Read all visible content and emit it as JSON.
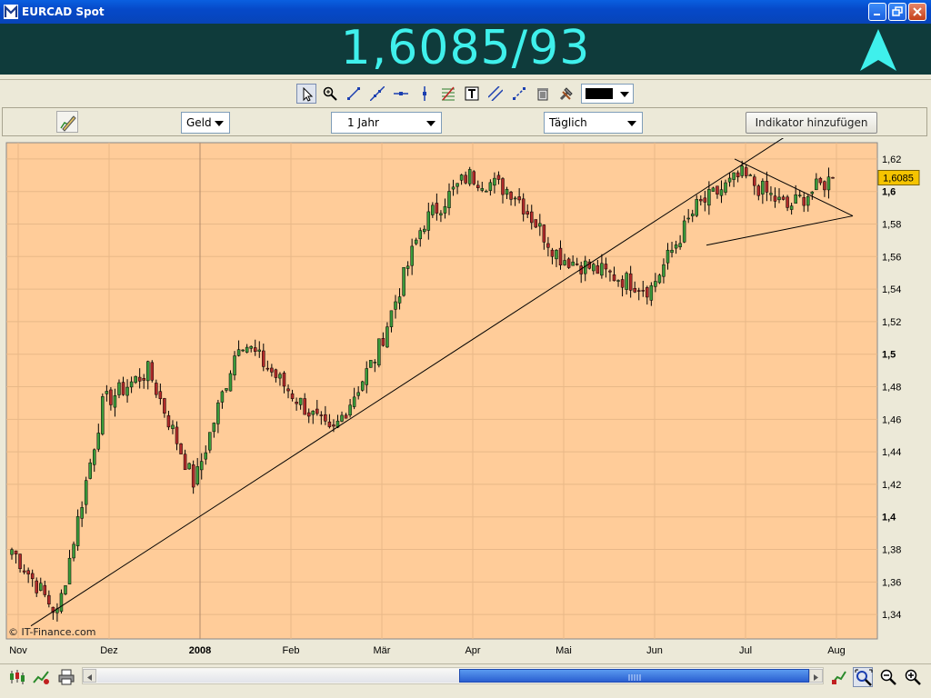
{
  "window": {
    "title": "EURCAD Spot"
  },
  "quote": {
    "price_text": "1,6085/93",
    "direction": "up",
    "color": "#3ff0ec",
    "background": "#0f3b3b"
  },
  "toolbar": {
    "tools": [
      "cursor-icon",
      "zoom-icon",
      "trendline-icon",
      "extended-line-icon",
      "horizontal-line-icon",
      "vertical-line-icon",
      "fibonacci-icon",
      "text-icon",
      "parallel-lines-icon",
      "ray-icon",
      "trash-icon",
      "properties-icon"
    ],
    "line_color": "#000000"
  },
  "controls": {
    "price_side": "Geld",
    "period": "1 Jahr",
    "interval": "Täglich",
    "add_indicator_label": "Indikator hinzufügen"
  },
  "chart_data": {
    "type": "candlestick",
    "instrument": "EURCAD",
    "background": "#ffcc99",
    "x_tick_labels": [
      "Nov",
      "Dez",
      "2008",
      "Feb",
      "Mär",
      "Apr",
      "Mai",
      "Jun",
      "Jul",
      "Aug"
    ],
    "y_tick_labels": [
      "1,62",
      "1,6",
      "1,58",
      "1,56",
      "1,54",
      "1,52",
      "1,5",
      "1,48",
      "1,46",
      "1,44",
      "1,42",
      "1,4",
      "1,38",
      "1,36",
      "1,34"
    ],
    "y_range": [
      1.325,
      1.63
    ],
    "last_price_label": "1,6085",
    "last_price": 1.6085,
    "approx_close_path": [
      {
        "month": "Nov",
        "close": 1.38
      },
      {
        "month": "Nov",
        "close": 1.34
      },
      {
        "month": "Dez",
        "close": 1.47
      },
      {
        "month": "Dez",
        "close": 1.49
      },
      {
        "month": "2008",
        "close": 1.42
      },
      {
        "month": "2008",
        "close": 1.51
      },
      {
        "month": "Feb",
        "close": 1.48
      },
      {
        "month": "Feb",
        "close": 1.45
      },
      {
        "month": "Mär",
        "close": 1.5
      },
      {
        "month": "Mär",
        "close": 1.58
      },
      {
        "month": "Apr",
        "close": 1.61
      },
      {
        "month": "Apr",
        "close": 1.6
      },
      {
        "month": "Mai",
        "close": 1.56
      },
      {
        "month": "Mai",
        "close": 1.55
      },
      {
        "month": "Jun",
        "close": 1.54
      },
      {
        "month": "Jun",
        "close": 1.59
      },
      {
        "month": "Jul",
        "close": 1.61
      },
      {
        "month": "Jul",
        "close": 1.59
      },
      {
        "month": "Aug",
        "close": 1.6085
      }
    ],
    "grid": true,
    "copyright": "© IT-Finance.com"
  }
}
